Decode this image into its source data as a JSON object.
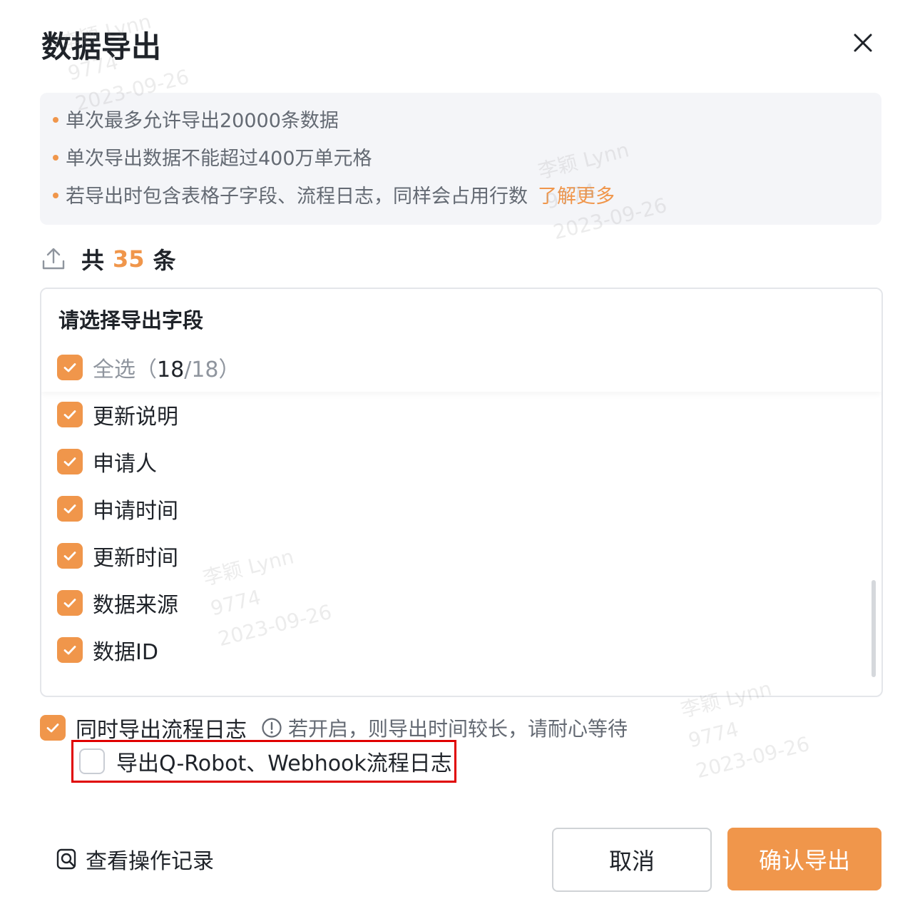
{
  "dialog": {
    "title": "数据导出",
    "notice": {
      "lines": [
        "单次最多允许导出20000条数据",
        "单次导出数据不能超过400万单元格",
        "若导出时包含表格子字段、流程日志，同样会占用行数"
      ],
      "learn_more": "了解更多"
    },
    "count": {
      "prefix": "共",
      "number": "35",
      "suffix": "条"
    },
    "fields": {
      "title": "请选择导出字段",
      "select_all_label": "全选（",
      "selected_count": "18",
      "total_count": "/18）",
      "items": [
        {
          "label": "更新说明",
          "checked": true
        },
        {
          "label": "申请人",
          "checked": true
        },
        {
          "label": "申请时间",
          "checked": true
        },
        {
          "label": "更新时间",
          "checked": true
        },
        {
          "label": "数据来源",
          "checked": true
        },
        {
          "label": "数据ID",
          "checked": true
        }
      ]
    },
    "export_log": {
      "label": "同时导出流程日志",
      "checked": true,
      "warning": "若开启，则导出时间较长，请耐心等待"
    },
    "export_robot_log": {
      "label": "导出Q-Robot、Webhook流程日志",
      "checked": false
    },
    "footer": {
      "history_label": "查看操作记录",
      "cancel_label": "取消",
      "confirm_label": "确认导出"
    }
  },
  "watermark": {
    "name": "李颖 Lynn",
    "id": "9774",
    "date": "2023-09-26"
  },
  "colors": {
    "accent": "#f0964b",
    "highlight_border": "#e00000"
  }
}
